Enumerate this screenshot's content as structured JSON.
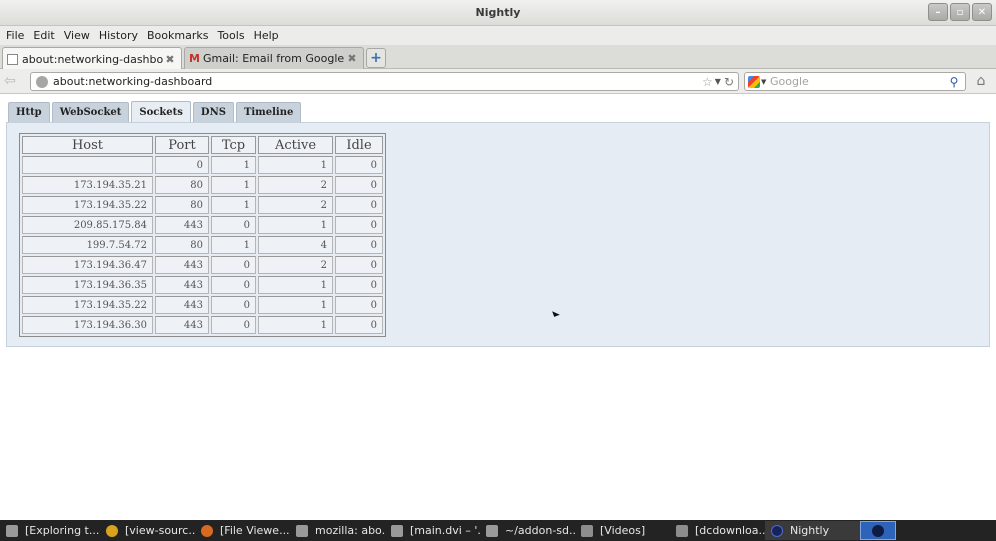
{
  "window": {
    "title": "Nightly",
    "min": "–",
    "max": "▫",
    "close": "✕"
  },
  "menu": [
    "File",
    "Edit",
    "View",
    "History",
    "Bookmarks",
    "Tools",
    "Help"
  ],
  "tabs": [
    {
      "label": "about:networking-dashboard",
      "active": true,
      "icon": "page-icon"
    },
    {
      "label": "Gmail: Email from Google",
      "active": false,
      "icon": "gmail-icon"
    }
  ],
  "tab_close": "✖",
  "new_tab": "+",
  "nav": {
    "back": "⇦",
    "url": "about:networking-dashboard",
    "star": "☆",
    "dropdown": "▼",
    "reload": "↻",
    "search_placeholder": "Google",
    "search_go": "🔍",
    "home": "⌂"
  },
  "dashboard": {
    "tabs": [
      {
        "label": "Http",
        "active": false
      },
      {
        "label": "WebSocket",
        "active": false
      },
      {
        "label": "Sockets",
        "active": true
      },
      {
        "label": "DNS",
        "active": false
      },
      {
        "label": "Timeline",
        "active": false
      }
    ],
    "columns": [
      "Host",
      "Port",
      "Tcp",
      "Active",
      "Idle"
    ],
    "rows": [
      [
        "",
        "0",
        "1",
        "1",
        "0"
      ],
      [
        "173.194.35.21",
        "80",
        "1",
        "2",
        "0"
      ],
      [
        "173.194.35.22",
        "80",
        "1",
        "2",
        "0"
      ],
      [
        "209.85.175.84",
        "443",
        "0",
        "1",
        "0"
      ],
      [
        "199.7.54.72",
        "80",
        "1",
        "4",
        "0"
      ],
      [
        "173.194.36.47",
        "443",
        "0",
        "2",
        "0"
      ],
      [
        "173.194.36.35",
        "443",
        "0",
        "1",
        "0"
      ],
      [
        "173.194.35.22",
        "443",
        "0",
        "1",
        "0"
      ],
      [
        "173.194.36.30",
        "443",
        "0",
        "1",
        "0"
      ]
    ]
  },
  "taskbar": [
    {
      "label": "[Exploring t...",
      "icon": "doc",
      "active": false
    },
    {
      "label": "[view-sourc...",
      "icon": "chrome",
      "active": false
    },
    {
      "label": "[File Viewe...",
      "icon": "firefox",
      "active": false
    },
    {
      "label": "mozilla: abo...",
      "icon": "doc",
      "active": false
    },
    {
      "label": "[main.dvi – '...",
      "icon": "doc",
      "active": false
    },
    {
      "label": "~/addon-sd...",
      "icon": "doc",
      "active": false
    },
    {
      "label": "[Videos]",
      "icon": "folder",
      "active": false
    },
    {
      "label": "[dcdownloa...",
      "icon": "folder",
      "active": false
    },
    {
      "label": "Nightly",
      "icon": "nightly",
      "active": true
    }
  ]
}
